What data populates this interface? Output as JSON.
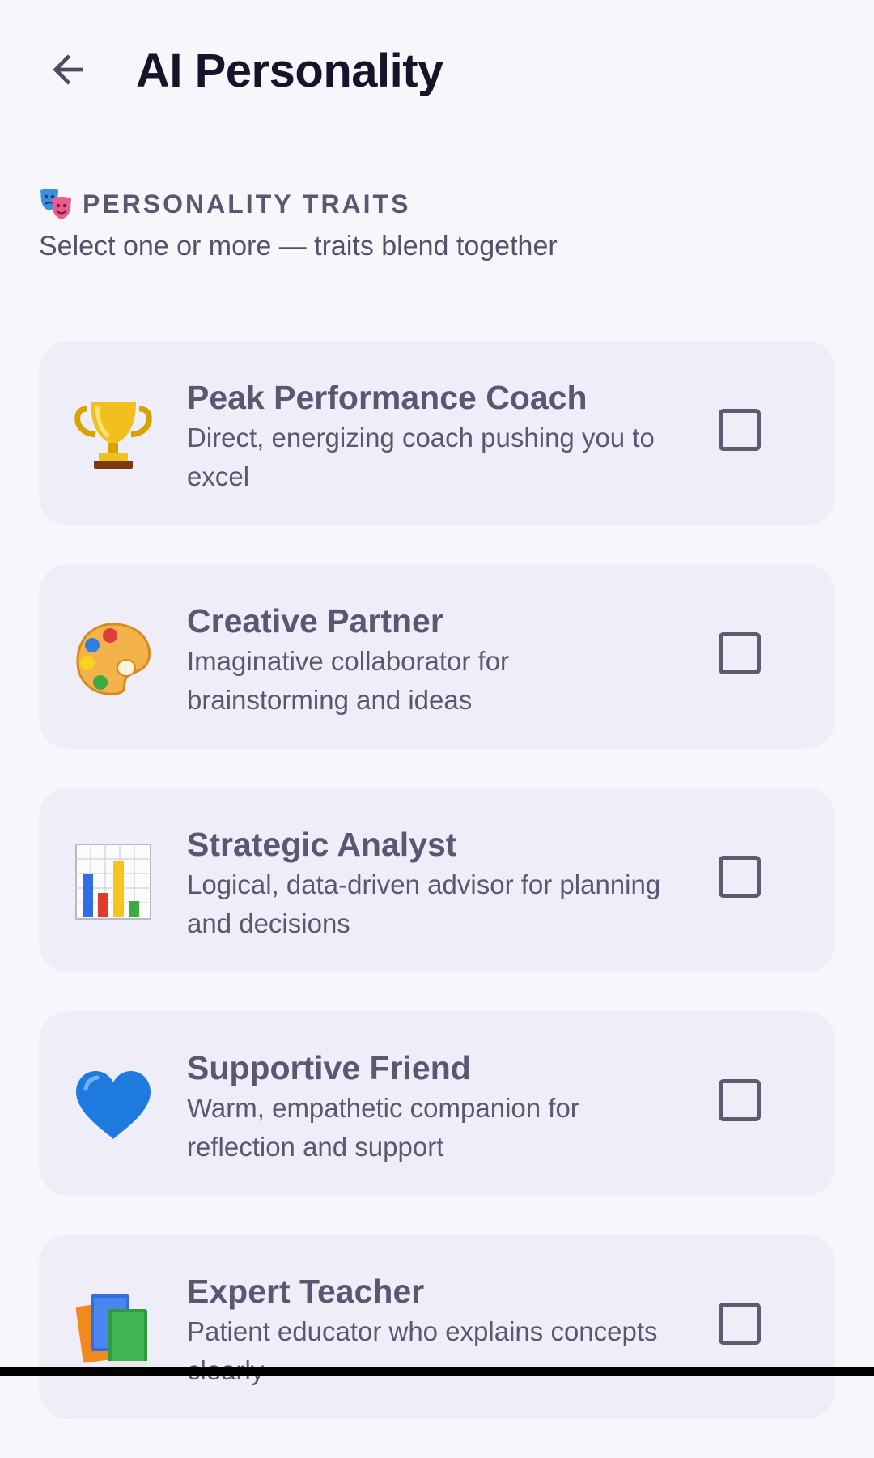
{
  "app_bar": {
    "title": "AI Personality"
  },
  "section": {
    "title": "PERSONALITY TRAITS",
    "subtitle": "Select one or more — traits blend together",
    "icon": "theater-masks-icon"
  },
  "traits": [
    {
      "name": "Peak Performance Coach",
      "description": "Direct, energizing coach pushing you to excel",
      "icon": "trophy-icon",
      "checked": false
    },
    {
      "name": "Creative Partner",
      "description": "Imaginative collaborator for brainstorming and ideas",
      "icon": "palette-icon",
      "checked": false
    },
    {
      "name": "Strategic Analyst",
      "description": "Logical, data-driven advisor for planning and decisions",
      "icon": "bar-chart-icon",
      "checked": false
    },
    {
      "name": "Supportive Friend",
      "description": "Warm, empathetic companion for reflection and support",
      "icon": "blue-heart-icon",
      "checked": false
    },
    {
      "name": "Expert Teacher",
      "description": "Patient educator who explains concepts clearly",
      "icon": "books-icon",
      "checked": false
    }
  ],
  "colors": {
    "background": "#f6f6fb",
    "card": "#efedf7",
    "title": "#16142a",
    "muted_text": "#5b5773",
    "checkbox_border": "#5e5a72"
  }
}
